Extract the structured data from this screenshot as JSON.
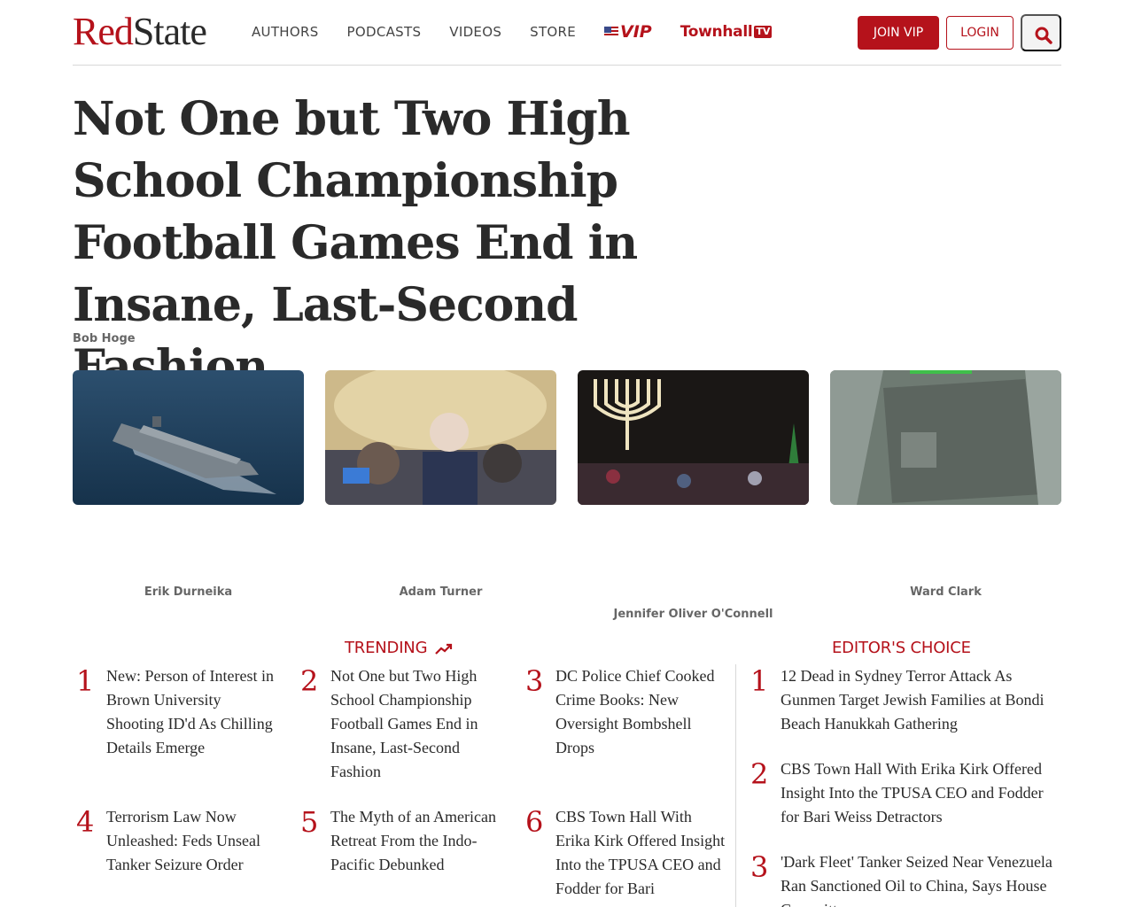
{
  "header": {
    "logo_part1": "Red",
    "logo_part2": "State",
    "nav": [
      "AUTHORS",
      "PODCASTS",
      "VIDEOS",
      "STORE"
    ],
    "vip_label": "VIP",
    "townhall_label": "Townhall",
    "townhall_badge": "TV",
    "join_label": "JOIN VIP",
    "login_label": "LOGIN",
    "search_icon": "search-icon"
  },
  "article": {
    "title": "Not One but Two High School Championship Football Games End in Insane, Last-Second Fashion",
    "author": "Bob Hoge"
  },
  "cards": [
    {
      "author": "Erik Durneika",
      "image": "aircraft-carrier-photo"
    },
    {
      "author": "Adam Turner",
      "image": "senator-press-photo"
    },
    {
      "author": "Jennifer Oliver O'Connell",
      "image": "menorah-night-crowd-photo"
    },
    {
      "author": "Ward Clark",
      "image": "tanker-ship-aerial-photo"
    }
  ],
  "trending": {
    "title": "TRENDING",
    "items": [
      {
        "num": "1",
        "text": "New: Person of Interest in Brown University Shooting ID'd As Chilling Details Emerge"
      },
      {
        "num": "2",
        "text": "Not One but Two High School Championship Football Games End in Insane, Last-Second Fashion"
      },
      {
        "num": "3",
        "text": "DC Police Chief Cooked Crime Books: New Oversight Bombshell Drops"
      },
      {
        "num": "4",
        "text": "Terrorism Law Now Unleashed: Feds Unseal Tanker Seizure Order"
      },
      {
        "num": "5",
        "text": "The Myth of an American Retreat From the Indo-Pacific Debunked"
      },
      {
        "num": "6",
        "text": "CBS Town Hall With Erika Kirk Offered Insight Into the TPUSA CEO and Fodder for Bari"
      }
    ]
  },
  "editors": {
    "title": "EDITOR'S CHOICE",
    "items": [
      {
        "num": "1",
        "text": "12 Dead in Sydney Terror Attack As Gunmen Target Jewish Families at Bondi Beach Hanukkah Gathering"
      },
      {
        "num": "2",
        "text": "CBS Town Hall With Erika Kirk Offered Insight Into the TPUSA CEO and Fodder for Bari Weiss Detractors"
      },
      {
        "num": "3",
        "text": "'Dark Fleet' Tanker Seized Near Venezuela Ran Sanctioned Oil to China, Says House Committee"
      }
    ]
  },
  "colors": {
    "brand_red": "#b5121b",
    "text_dark": "#2a2a2a",
    "text_gray": "#666666"
  }
}
